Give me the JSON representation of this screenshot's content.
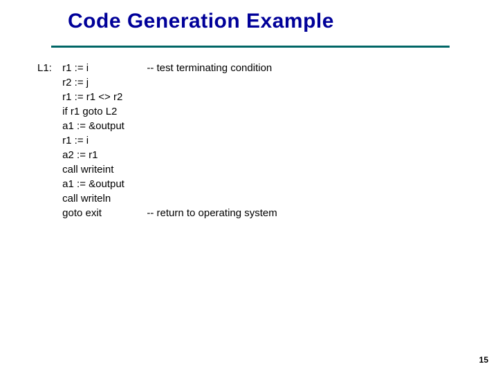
{
  "title": "Code Generation Example",
  "page_number": "15",
  "code": {
    "lines": [
      {
        "label": "L1:",
        "instr": "r1 := i",
        "comment": "-- test terminating condition"
      },
      {
        "label": "",
        "instr": "r2 := j",
        "comment": ""
      },
      {
        "label": "",
        "instr": "r1 := r1 <> r2",
        "comment": ""
      },
      {
        "label": "",
        "instr": "if r1 goto L2",
        "comment": ""
      },
      {
        "label": "",
        "instr": "a1 := &output",
        "comment": ""
      },
      {
        "label": "",
        "instr": "r1 := i",
        "comment": ""
      },
      {
        "label": "",
        "instr": "a2 := r1",
        "comment": ""
      },
      {
        "label": "",
        "instr": "call writeint",
        "comment": ""
      },
      {
        "label": "",
        "instr": "a1 := &output",
        "comment": ""
      },
      {
        "label": "",
        "instr": "call writeln",
        "comment": ""
      },
      {
        "label": "",
        "instr": "goto exit",
        "comment": "-- return to operating system"
      }
    ]
  }
}
